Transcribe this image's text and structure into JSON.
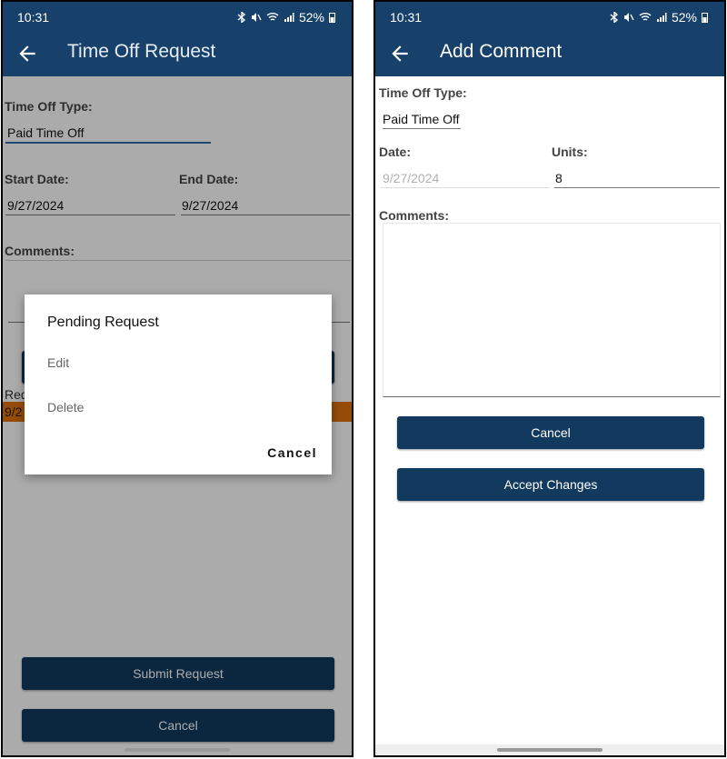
{
  "status": {
    "time": "10:31",
    "battery": "52%"
  },
  "left": {
    "title": "Time Off Request",
    "time_off_type_label": "Time Off Type:",
    "time_off_type_value": "Paid Time Off",
    "start_date_label": "Start Date:",
    "start_date_value": "9/27/2024",
    "end_date_label": "End Date:",
    "end_date_value": "9/27/2024",
    "comments_label": "Comments:",
    "requests_label_partial": "Req",
    "request_row_partial": "9/2",
    "submit_label": "Submit Request",
    "cancel_label": "Cancel",
    "dialog": {
      "title": "Pending Request",
      "edit": "Edit",
      "delete": "Delete",
      "cancel": "Cancel"
    },
    "colors": {
      "header": "#17416a",
      "button": "#113a5e",
      "accent_underline": "#2e6ea6",
      "row_highlight": "#e0720a"
    }
  },
  "right": {
    "title": "Add Comment",
    "time_off_type_label": "Time Off Type:",
    "time_off_type_value": "Paid Time Off",
    "date_label": "Date:",
    "date_value": "9/27/2024",
    "units_label": "Units:",
    "units_value": "8",
    "comments_label": "Comments:",
    "cancel_label": "Cancel",
    "accept_label": "Accept Changes"
  },
  "icons": [
    "back-arrow-icon",
    "bluetooth-icon",
    "mute-icon",
    "wifi-icon",
    "signal-icon",
    "battery-icon"
  ]
}
